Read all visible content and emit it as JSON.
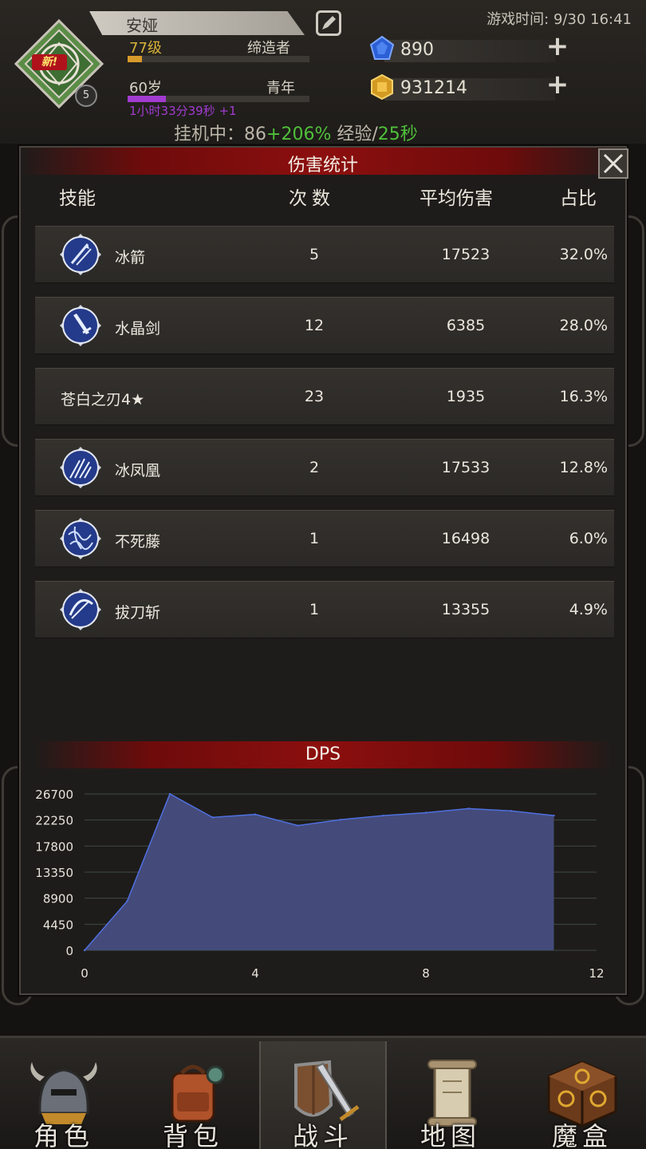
{
  "header": {
    "new_badge": "新!",
    "level_badge": "5",
    "name": "安娅",
    "level": "77级",
    "class": "缔造者",
    "level_progress": 0.08,
    "age": "60岁",
    "stage": "青年",
    "age_progress": 0.21,
    "age_timer": "1小时33分39秒 +1",
    "game_time": "游戏时间: 9/30 16:41",
    "gem_amount": "890",
    "gold_amount": "931214",
    "idle_prefix": "挂机中：",
    "idle_value": "86",
    "idle_bonus": "+206%",
    "idle_exp_label": " 经验/",
    "idle_rate": "25秒"
  },
  "dialog": {
    "title": "伤害统计",
    "close_icon": "close-icon",
    "columns": {
      "skill": "技能",
      "count": "次数",
      "avg": "平均伤害",
      "pct": "占比"
    },
    "rows": [
      {
        "name": "冰箭",
        "count": "5",
        "avg": "17523",
        "pct": "32.0%",
        "icon": "ice-arrow-icon"
      },
      {
        "name": "水晶剑",
        "count": "12",
        "avg": "6385",
        "pct": "28.0%",
        "icon": "crystal-sword-icon"
      },
      {
        "name": "苍白之刃4★",
        "count": "23",
        "avg": "1935",
        "pct": "16.3%",
        "icon": ""
      },
      {
        "name": "冰凤凰",
        "count": "2",
        "avg": "17533",
        "pct": "12.8%",
        "icon": "ice-phoenix-icon"
      },
      {
        "name": "不死藤",
        "count": "1",
        "avg": "16498",
        "pct": "6.0%",
        "icon": "undying-vine-icon"
      },
      {
        "name": "拔刀斩",
        "count": "1",
        "avg": "13355",
        "pct": "4.9%",
        "icon": "iaido-slash-icon"
      }
    ],
    "dps_title": "DPS"
  },
  "chart_data": {
    "type": "area",
    "title": "DPS",
    "xlabel": "",
    "ylabel": "",
    "x": [
      0,
      1,
      2,
      3,
      4,
      5,
      6,
      7,
      8,
      9,
      10,
      11
    ],
    "values": [
      0,
      8400,
      26700,
      22700,
      23200,
      21300,
      22300,
      23000,
      23500,
      24200,
      23800,
      23000
    ],
    "xlim": [
      0,
      12
    ],
    "ylim": [
      0,
      26700
    ],
    "xticks": [
      0,
      4,
      8,
      12
    ],
    "yticks": [
      0,
      4450,
      8900,
      13350,
      17800,
      22250,
      26700
    ],
    "grid": true,
    "fill_color": "#444b7a",
    "line_color": "#4f6fe0"
  },
  "nav": [
    {
      "label": "角色",
      "icon": "helmet-icon"
    },
    {
      "label": "背包",
      "icon": "backpack-icon"
    },
    {
      "label": "战斗",
      "icon": "shield-sword-icon"
    },
    {
      "label": "地图",
      "icon": "scroll-map-icon"
    },
    {
      "label": "魔盒",
      "icon": "magic-box-icon"
    }
  ],
  "colors": {
    "accent_red": "#8c0f0f",
    "exp_green": "#4fc03a",
    "age_purple": "#a23bd0",
    "level_gold": "#d8b23a"
  }
}
